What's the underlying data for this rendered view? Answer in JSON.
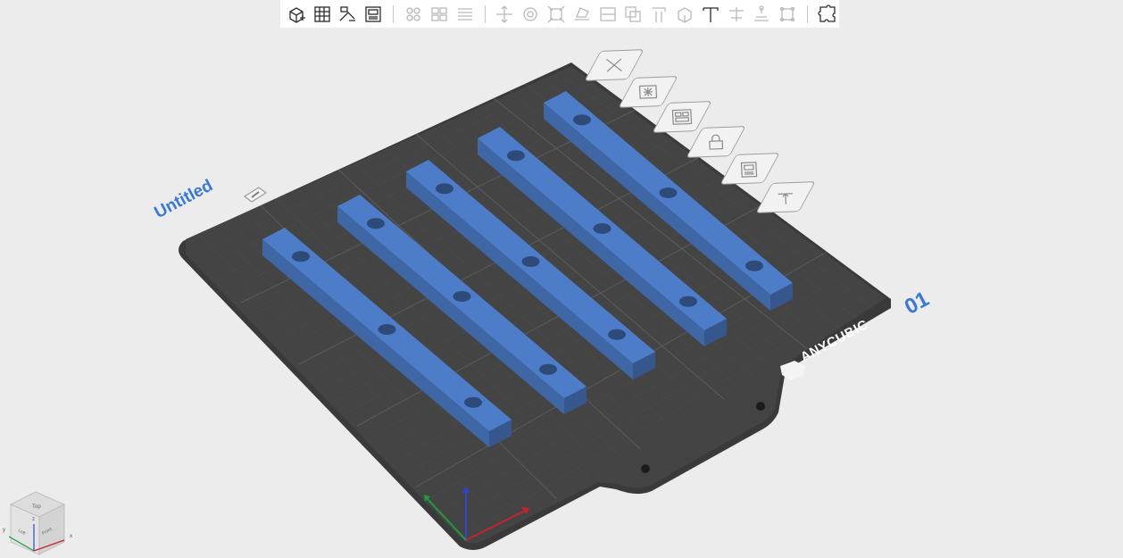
{
  "app": {
    "project_name": "Untitled",
    "plate_number": "01",
    "brand": "ANYCUBIC"
  },
  "toolbar": {
    "groups": [
      {
        "buttons": [
          {
            "name": "add-model-icon",
            "enabled": true
          },
          {
            "name": "arrange-grid-icon",
            "enabled": true
          },
          {
            "name": "auto-orient-icon",
            "enabled": true
          },
          {
            "name": "plate-settings-icon",
            "enabled": true
          }
        ]
      },
      {
        "buttons": [
          {
            "name": "clone-icon",
            "enabled": false
          },
          {
            "name": "array-icon",
            "enabled": false
          },
          {
            "name": "layers-icon",
            "enabled": false
          }
        ]
      },
      {
        "buttons": [
          {
            "name": "move-icon",
            "enabled": false
          },
          {
            "name": "rotate-icon",
            "enabled": false
          },
          {
            "name": "scale-icon",
            "enabled": false
          },
          {
            "name": "lay-flat-icon",
            "enabled": false
          },
          {
            "name": "cut-icon",
            "enabled": false
          },
          {
            "name": "boolean-icon",
            "enabled": false
          },
          {
            "name": "support-paint-icon",
            "enabled": false
          },
          {
            "name": "seam-paint-icon",
            "enabled": false
          },
          {
            "name": "text-icon",
            "enabled": true
          },
          {
            "name": "measure-icon",
            "enabled": false
          },
          {
            "name": "assembly-icon",
            "enabled": false
          },
          {
            "name": "split-icon",
            "enabled": false
          }
        ]
      },
      {
        "buttons": [
          {
            "name": "puzzle-icon",
            "enabled": true
          }
        ]
      }
    ]
  },
  "plate_tools": [
    {
      "name": "delete-plate-icon"
    },
    {
      "name": "auto-orient-plate-icon"
    },
    {
      "name": "arrange-plate-icon"
    },
    {
      "name": "lock-plate-icon"
    },
    {
      "name": "plate-settings-icon"
    },
    {
      "name": "move-plate-icon"
    }
  ],
  "objects": {
    "count": 5,
    "color": "#4d7cc9"
  },
  "view_cube": {
    "faces": {
      "top": "Top",
      "front": "Front",
      "left": "Left"
    },
    "axes": {
      "x": "x",
      "y": "y",
      "z": "z"
    }
  },
  "colors": {
    "accent": "#3a78d8",
    "plate": "#3b3b3b",
    "background": "#ececec"
  }
}
